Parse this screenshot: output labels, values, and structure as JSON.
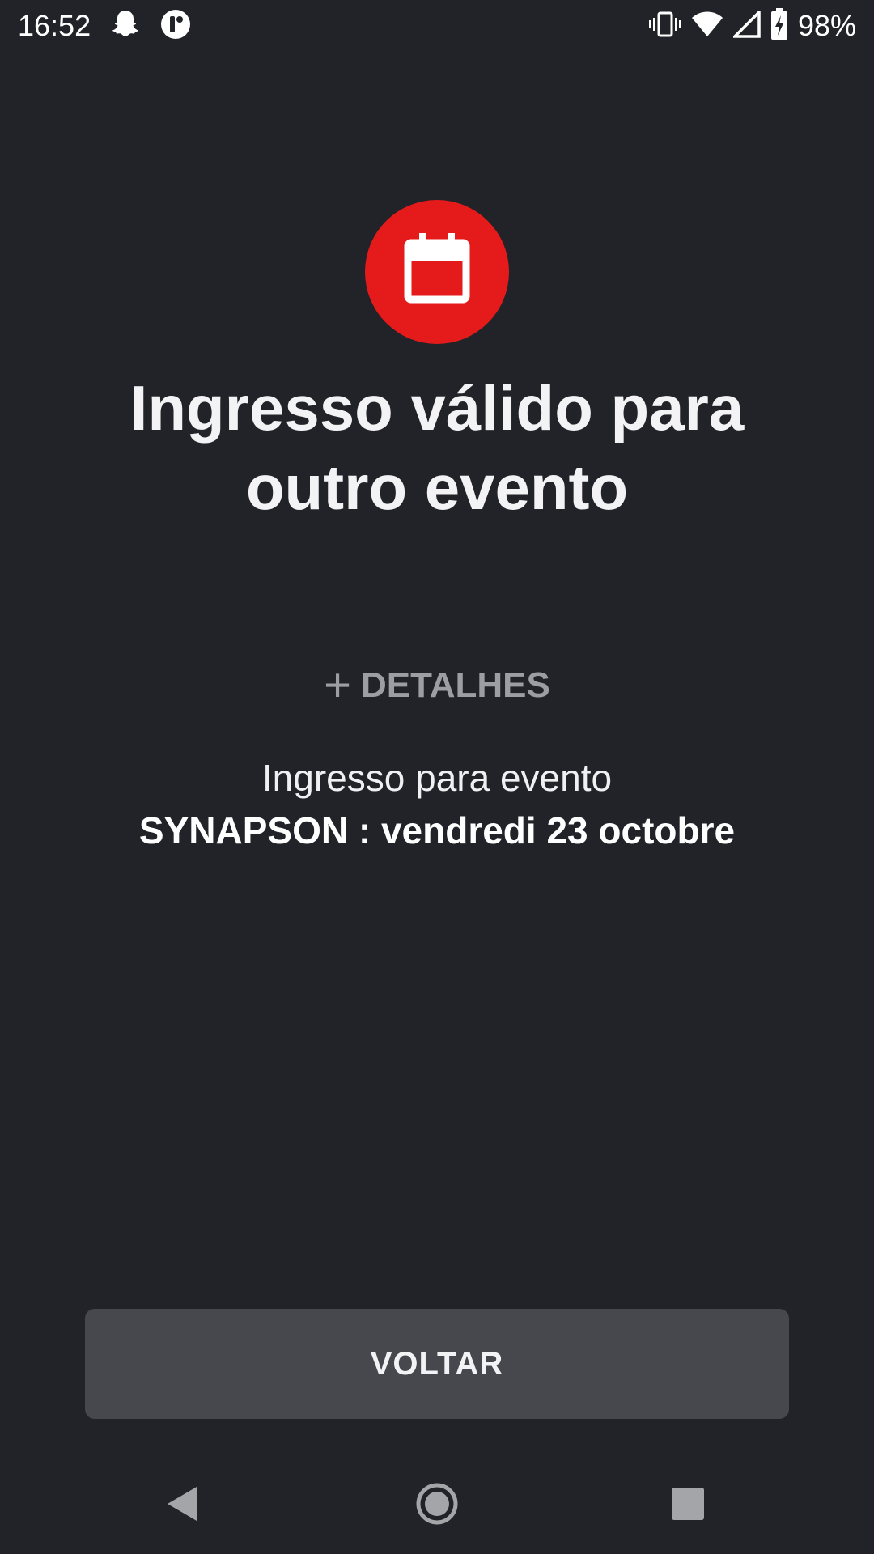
{
  "status_bar": {
    "time": "16:52",
    "left_icons": [
      "snapchat-icon",
      "app-notification-icon"
    ],
    "right_icons": [
      "vibrate-icon",
      "wifi-icon",
      "signal-icon",
      "battery-charging-icon"
    ],
    "battery_percent": "98%"
  },
  "main": {
    "icon": "calendar-icon",
    "icon_color": "#e51b1b",
    "title_line1": "Ingresso válido para",
    "title_line2": "outro evento",
    "details_label": "DETALHES",
    "details_icon": "plus-icon",
    "ticket_line1": "Ingresso para evento",
    "ticket_line2": "SYNAPSON : vendredi 23 octobre"
  },
  "actions": {
    "back_label": "VOLTAR"
  },
  "nav_bar": {
    "items": [
      "back-icon",
      "home-icon",
      "recents-icon"
    ]
  }
}
